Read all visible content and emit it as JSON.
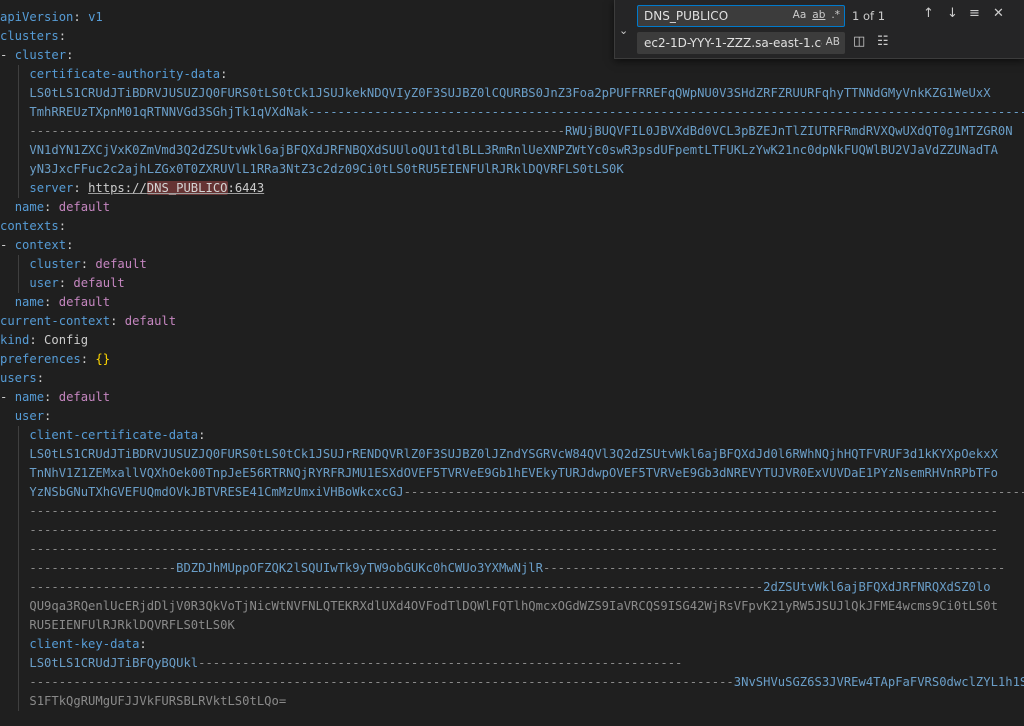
{
  "find_widget": {
    "search_value": "DNS_PUBLICO",
    "replace_value": "ec2-1D-YYY-1-ZZZ.sa-east-1.cc",
    "match_case_label": "Aa",
    "whole_word_label": "ab",
    "regex_label": ".*",
    "preserve_case_label": "AB",
    "match_count": "1 of 1",
    "toggle_icon": "chevron-down-icon",
    "prev_icon": "arrow-up-icon",
    "next_icon": "arrow-down-icon",
    "selection_icon": "find-in-selection-icon",
    "close_icon": "close-icon"
  },
  "editor": {
    "lines": {
      "l1k": "apiVersion",
      "l1v": "v1",
      "l2k": "clusters",
      "l3k": "cluster",
      "l4k": "certificate-authority-data",
      "l5": "LS0tLS1CRUdJTiBDRVJUSUZJQ0FURS0tLS0tCk1JSUJkekNDQVIyZ0F3SUJBZ0lCQURBS0JnZ3Foa2pPUFFRREFqQWpNU0V3SHdZRFZRUURFqhyTTNNdGMyVnkKZG1WeUxX",
      "l6": "TmhRREUzTXpnM01qRTNNVGd3SGhjTk1qVXdNak----------------------------------------------------------------------------------------------------",
      "l7a": "-------------------------------------------------------------------------",
      "l7b": "RWUjBUQVFIL0JBVXdBd0VCL3pBZEJnTlZIUTRFRmdRVXQwUXdQT0g1MTZGR0N",
      "l8": "VN1dYN1ZXCjVxK0ZmVmd3Q2dZSUtvWkl6ajBFQXdJRFNBQXdSUUloQU1tdlBLL3RmRnlUeXNPZWtYc0swR3psdUFpemtLTFUKLzYwK21nc0dpNkFUQWlBU2VJaVdZZUNadTA",
      "l9": "yN3JxcFFuc2c2ajhLZGx0T0ZXRUVlL1RRa3NtZ3c2dz09Ci0tLS0tRU5EIENFUlRJRklDQVRFLS0tLS0K",
      "l10k": "server",
      "l10url1": "https://",
      "l10hl": "DNS_PUBLICO",
      "l10url2": ":6443",
      "l11k": "name",
      "l11v": "default",
      "l12k": "contexts",
      "l13k": "context",
      "l14k": "cluster",
      "l14v": "default",
      "l15k": "user",
      "l15v": "default",
      "l16k": "name",
      "l16v": "default",
      "l17k": "current-context",
      "l17v": "default",
      "l18k": "kind",
      "l18v": "Config",
      "l19k": "preferences",
      "l19v": "{}",
      "l20k": "users",
      "l21k": "name",
      "l21v": "default",
      "l22k": "user",
      "l23k": "client-certificate-data",
      "l24": "LS0tLS1CRUdJTiBDRVJUSUZJQ0FURS0tLS0tCk1JSUJrRENDQVRlZ0F3SUJBZ0lJZndYSGRVcW84QVl3Q2dZSUtvWkl6ajBFQXdJd0l6RWhNQjhHQTFVRUF3d1kKYXpOekxX",
      "l25": "TnNhV1Z1ZEMxallVQXhOek00TnpJeE56RTRNQjRYRFRJMU1ESXdOVEF5TVRVeE9Gb1hEVEkyTURJdwpOVEF5TVRVeE9Gb3dNREVYTUJVR0ExVUVDaE1PYzNsemRHVnRPbTFo",
      "l26a": "YzNSbGNuTXhGVEFUQmdOVkJBTVRESE41CmMzUmxiVHBoWkcxcGJ",
      "l26b": "-------------------------------------------------------------------------------------------",
      "l27": "------------------------------------------------------------------------------------------------------------------------------------",
      "l28": "------------------------------------------------------------------------------------------------------------------------------------",
      "l29": "------------------------------------------------------------------------------------------------------------------------------------",
      "l30a": "--------------------",
      "l30b": "BDZDJhMUppOFZQK2lSQUIwTk9yTW9obGUKc0hCWUo3YXMwNjlR",
      "l30c": "---------------------------------------------------------------",
      "l31a": "----------------------------------------------------------------------------------------------------",
      "l31b": "2dZSUtvWkl6ajBFQXdJRFNRQXdSZ0lo",
      "l32": "QU9qa3RQenlUcERjdDljV0R3QkVoTjNicWtNVFNLQTEKRXdlUXd4OVFodTlDQWlFQTlhQmcxOGdWZS9IaVRCQS9ISG42WjRsVFpvK21yRW5JSUJlQkJFME4wcms9Ci0tLS0t",
      "l33": "RU5EIENFUlRJRklDQVRFLS0tLS0K",
      "l34k": "client-key-data",
      "l35a": "LS0tLS1CRUdJTiBFQyBQUkl",
      "l35b": "------------------------------------------------------------------",
      "l36a": "------------------------------------------------------------------------------------------------",
      "l36b": "3NvSHVuSGZ6S3JVREw4TApFaFVRS0dwclZYL1h1SGN3cXpGY3lEdk96MmJ4ZkNuSHF3PT0KLS0tL",
      "l37": "S1FTkQgRUMgUFJJVkFURSBLRVktLS0tLQo="
    }
  }
}
